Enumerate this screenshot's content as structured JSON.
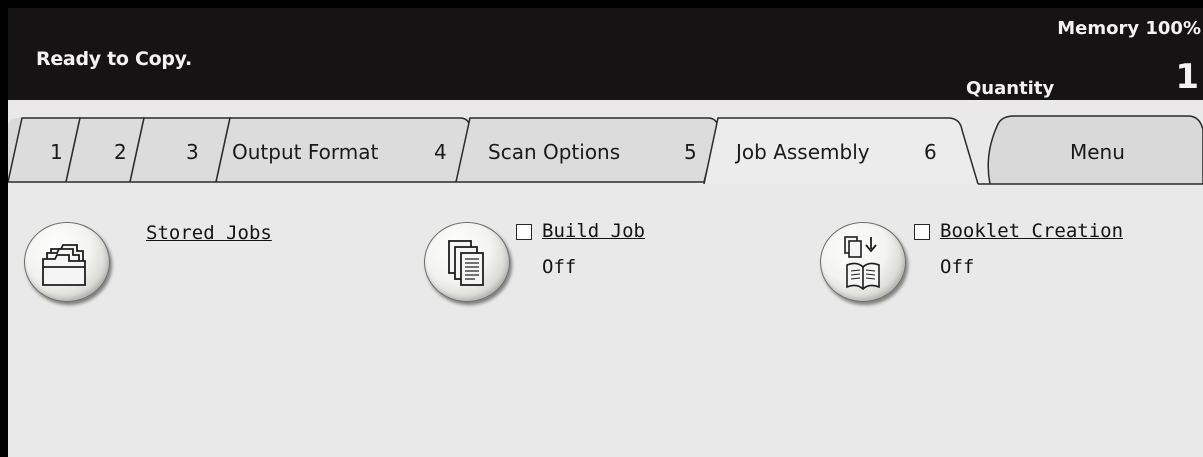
{
  "header": {
    "status": "Ready to Copy.",
    "memory": "Memory 100%",
    "quantity_label": "Quantity",
    "quantity_value": "1"
  },
  "tabs": [
    {
      "number": "1",
      "label": ""
    },
    {
      "number": "2",
      "label": ""
    },
    {
      "number": "3",
      "label": "Output Format"
    },
    {
      "number": "4",
      "label": "Scan Options"
    },
    {
      "number": "5",
      "label": "Job Assembly"
    },
    {
      "number": "6",
      "label": ""
    }
  ],
  "active_tab": "Job Assembly",
  "menu_label": "Menu",
  "features": {
    "stored_jobs": {
      "title": "Stored Jobs",
      "icon": "folder-icon"
    },
    "build_job": {
      "title": "Build Job",
      "value": "Off",
      "icon": "stacked-pages-icon",
      "checked": false
    },
    "booklet_creation": {
      "title": "Booklet Creation",
      "value": "Off",
      "icon": "booklet-icon",
      "checked": false
    }
  },
  "colors": {
    "header_bg": "#151313",
    "panel_bg": "#e9e9ea",
    "tab_inactive": "#dcdcdc",
    "tab_active": "#ececec"
  }
}
